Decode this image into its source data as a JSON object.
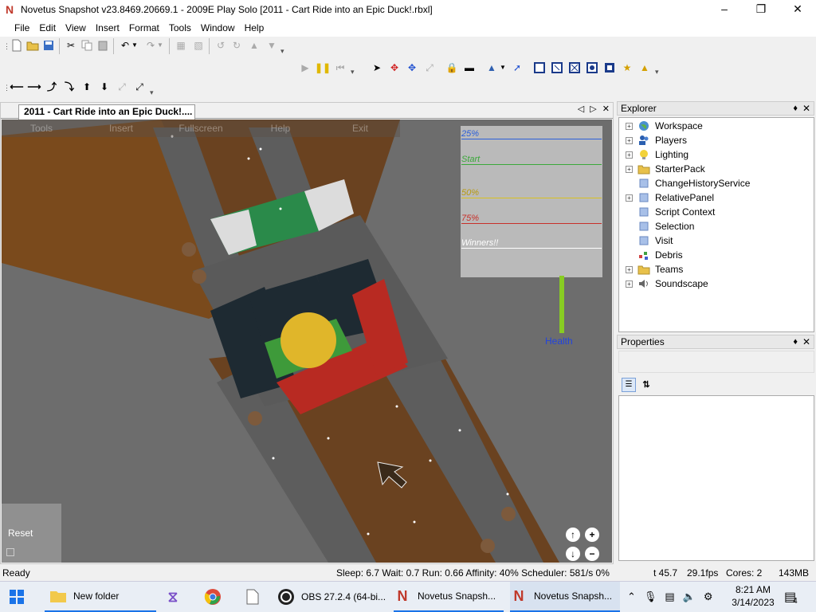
{
  "window": {
    "title": "Novetus Snapshot v23.8469.20669.1 - 2009E Play Solo [2011 - Cart Ride into an Epic Duck!.rbxl]",
    "app_icon": "N"
  },
  "menu": [
    "File",
    "Edit",
    "View",
    "Insert",
    "Format",
    "Tools",
    "Window",
    "Help"
  ],
  "document": {
    "tab_title": "2011 - Cart Ride into an Epic Duck!...."
  },
  "game": {
    "menu": [
      "Tools",
      "Insert",
      "Fullscreen",
      "Help",
      "Exit"
    ],
    "leaderboard": [
      {
        "label": "25%",
        "color": "#2b5fd9"
      },
      {
        "label": "Start",
        "color": "#3aa83a"
      },
      {
        "label": "50%",
        "color": "#d8c020"
      },
      {
        "label": "75%",
        "color": "#c8302a"
      },
      {
        "label": "Winners!!",
        "color": "#ffffff"
      }
    ],
    "health_label": "Health",
    "health_level": 1.0,
    "reset_label": "Reset"
  },
  "explorer": {
    "title": "Explorer",
    "items": [
      {
        "label": "Workspace",
        "icon": "globe-icon",
        "expandable": true
      },
      {
        "label": "Players",
        "icon": "players-icon",
        "expandable": true
      },
      {
        "label": "Lighting",
        "icon": "lightbulb-icon",
        "expandable": true
      },
      {
        "label": "StarterPack",
        "icon": "folder-icon",
        "expandable": true
      },
      {
        "label": "ChangeHistoryService",
        "icon": "service-icon",
        "expandable": false
      },
      {
        "label": "RelativePanel",
        "icon": "service-icon",
        "expandable": true
      },
      {
        "label": "Script Context",
        "icon": "service-icon",
        "expandable": false
      },
      {
        "label": "Selection",
        "icon": "service-icon",
        "expandable": false
      },
      {
        "label": "Visit",
        "icon": "service-icon",
        "expandable": false
      },
      {
        "label": "Debris",
        "icon": "debris-icon",
        "expandable": false
      },
      {
        "label": "Teams",
        "icon": "folder-icon",
        "expandable": true
      },
      {
        "label": "Soundscape",
        "icon": "speaker-icon",
        "expandable": true
      }
    ]
  },
  "properties": {
    "title": "Properties"
  },
  "status": {
    "ready": "Ready",
    "perf": "Sleep: 6.7 Wait: 0.7 Run: 0.66 Affinity: 40% Scheduler: 581/s 0%",
    "t": "t 45.7",
    "fps": "29.1fps",
    "cores": "Cores: 2",
    "mem": "143MB"
  },
  "taskbar": {
    "tasks": [
      {
        "label": "New folder",
        "icon": "folder-icon"
      },
      {
        "label": "",
        "icon": "visual-studio-icon"
      },
      {
        "label": "",
        "icon": "chrome-icon"
      },
      {
        "label": "",
        "icon": "document-icon"
      },
      {
        "label": "OBS 27.2.4 (64-bi...",
        "icon": "obs-icon"
      },
      {
        "label": "Novetus Snapsh...",
        "icon": "novetus-icon"
      },
      {
        "label": "Novetus Snapsh...",
        "icon": "novetus-icon"
      }
    ],
    "time": "8:21 AM",
    "date": "3/14/2023",
    "notifications": "4"
  }
}
